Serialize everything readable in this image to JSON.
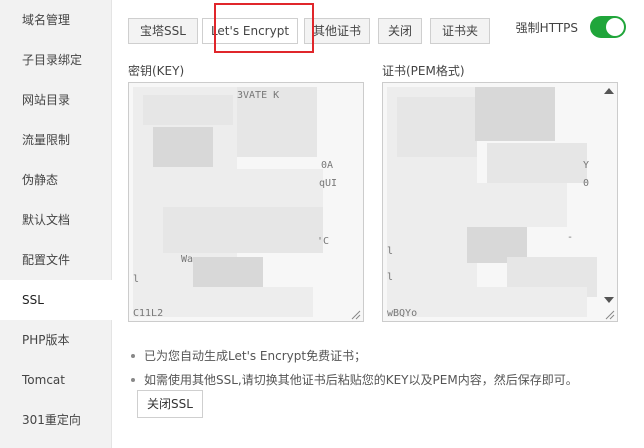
{
  "sidebar": {
    "items": [
      {
        "label": "域名管理"
      },
      {
        "label": "子目录绑定"
      },
      {
        "label": "网站目录"
      },
      {
        "label": "流量限制"
      },
      {
        "label": "伪静态"
      },
      {
        "label": "默认文档"
      },
      {
        "label": "配置文件"
      },
      {
        "label": "SSL",
        "active": true
      },
      {
        "label": "PHP版本"
      },
      {
        "label": "Tomcat"
      },
      {
        "label": "301重定向"
      }
    ]
  },
  "tabs": [
    {
      "label": "宝塔SSL"
    },
    {
      "label": "Let's Encrypt",
      "active": true
    },
    {
      "label": "其他证书"
    },
    {
      "label": "关闭"
    },
    {
      "label": "证书夹"
    }
  ],
  "https_toggle": {
    "label": "强制HTTPS",
    "on": true,
    "color": "#20a53a"
  },
  "key_field": {
    "label": "密钥(KEY)",
    "visible_fragments": [
      "3VATE K",
      "0A",
      "qUI",
      "'C",
      "Wa",
      "l",
      "C11L2"
    ]
  },
  "cert_field": {
    "label": "证书(PEM格式)",
    "visible_fragments": [
      "Y",
      "0",
      "-",
      "l",
      "l",
      "wBQYo"
    ]
  },
  "notes": [
    "已为您自动生成Let's Encrypt免费证书；",
    "如需使用其他SSL,请切换其他证书后粘贴您的KEY以及PEM内容，然后保存即可。"
  ],
  "close_ssl_button": {
    "label": "关闭SSL"
  },
  "colors": {
    "highlight": "#e0262b",
    "toggle_on": "#20a53a"
  }
}
